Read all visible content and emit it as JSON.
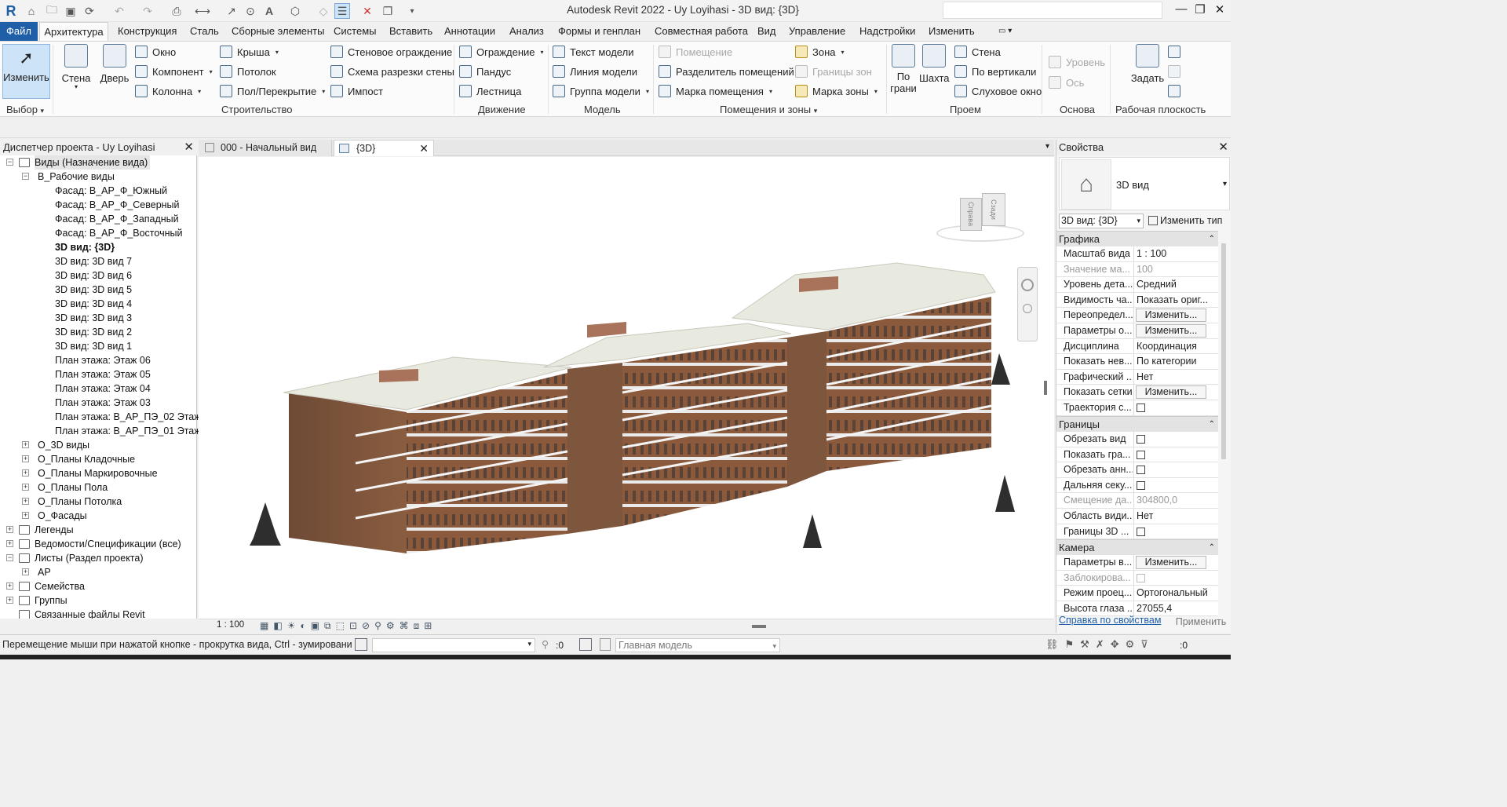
{
  "app": {
    "title": "Autodesk Revit 2022 - Uy Loyihasi - 3D вид: {3D}"
  },
  "colors": {
    "accent": "#1f5fa8",
    "selected": "#cde3f7",
    "facade": "#8b5a3c",
    "roof": "#e8e9df"
  },
  "menu_tabs": [
    "Файл",
    "Архитектура",
    "Конструкция",
    "Сталь",
    "Сборные элементы",
    "Системы",
    "Вставить",
    "Аннотации",
    "Анализ",
    "Формы и генплан",
    "Совместная работа",
    "Вид",
    "Управление",
    "Надстройки",
    "Изменить"
  ],
  "ribbon": {
    "select": {
      "modify": "Изменить",
      "group": "Выбор"
    },
    "build": {
      "wall": "Стена",
      "door": "Дверь",
      "window": "Окно",
      "component": "Компонент",
      "column": "Колонна",
      "roof": "Крыша",
      "ceiling": "Потолок",
      "floor": "Пол/Перекрытие",
      "curtain_system": "Стеновое ограждение",
      "curtain_grid": "Схема разрезки стены",
      "mullion": "Импост",
      "group": "Строительство"
    },
    "circulation": {
      "railing": "Ограждение",
      "ramp": "Пандус",
      "stair": "Лестница",
      "group": "Движение"
    },
    "model": {
      "model_text": "Текст модели",
      "model_line": "Линия  модели",
      "model_group": "Группа модели",
      "group": "Модель"
    },
    "rooms": {
      "room": "Помещение",
      "room_separator": "Разделитель помещений",
      "room_tag": "Марка помещения",
      "area": "Зона",
      "area_boundary": "Границы  зон",
      "area_tag": "Марка  зоны",
      "group": "Помещения и зоны"
    },
    "opening": {
      "by_face": "По\nграни",
      "shaft": "Шахта",
      "wall": "Стена",
      "vertical": "По вертикали",
      "dormer": "Слуховое окно",
      "group": "Проем"
    },
    "datum": {
      "level": "Уровень",
      "grid": "Ось",
      "group": "Основа"
    },
    "workplane": {
      "set": "Задать",
      "group": "Рабочая плоскость"
    }
  },
  "project_browser": {
    "title": "Диспетчер проекта - Uy Loyihasi",
    "items": [
      {
        "label": "Виды (Назначение вида)",
        "level": 0,
        "toggle": "−"
      },
      {
        "label": "В_Рабочие виды",
        "level": 1,
        "toggle": "−"
      },
      {
        "label": "Фасад: В_АР_Ф_Южный",
        "level": 2
      },
      {
        "label": "Фасад: В_АР_Ф_Северный",
        "level": 2
      },
      {
        "label": "Фасад: В_АР_Ф_Западный",
        "level": 2
      },
      {
        "label": "Фасад: В_АР_Ф_Восточный",
        "level": 2
      },
      {
        "label": "3D вид: {3D}",
        "level": 2,
        "bold": true
      },
      {
        "label": "3D вид: 3D вид 7",
        "level": 2
      },
      {
        "label": "3D вид: 3D вид 6",
        "level": 2
      },
      {
        "label": "3D вид: 3D вид 5",
        "level": 2
      },
      {
        "label": "3D вид: 3D вид 4",
        "level": 2
      },
      {
        "label": "3D вид: 3D вид 3",
        "level": 2
      },
      {
        "label": "3D вид: 3D вид 2",
        "level": 2
      },
      {
        "label": "3D вид: 3D вид 1",
        "level": 2
      },
      {
        "label": "План этажа: Этаж 06",
        "level": 2
      },
      {
        "label": "План этажа: Этаж 05",
        "level": 2
      },
      {
        "label": "План этажа: Этаж 04",
        "level": 2
      },
      {
        "label": "План этажа: Этаж 03",
        "level": 2
      },
      {
        "label": "План этажа: В_АР_ПЭ_02 Этаж",
        "level": 2
      },
      {
        "label": "План этажа: В_АР_ПЭ_01 Этаж",
        "level": 2
      },
      {
        "label": "О_3D виды",
        "level": 1,
        "toggle": "+"
      },
      {
        "label": "О_Планы Кладочные",
        "level": 1,
        "toggle": "+"
      },
      {
        "label": "О_Планы Маркировочные",
        "level": 1,
        "toggle": "+"
      },
      {
        "label": "О_Планы Пола",
        "level": 1,
        "toggle": "+"
      },
      {
        "label": "О_Планы Потолка",
        "level": 1,
        "toggle": "+"
      },
      {
        "label": "О_Фасады",
        "level": 1,
        "toggle": "+"
      },
      {
        "label": "Легенды",
        "level": 0,
        "toggle": "+"
      },
      {
        "label": "Ведомости/Спецификации (все)",
        "level": 0,
        "toggle": "+"
      },
      {
        "label": "Листы (Раздел проекта)",
        "level": 0,
        "toggle": "−"
      },
      {
        "label": "АР",
        "level": 1,
        "toggle": "+"
      },
      {
        "label": "Семейства",
        "level": 0,
        "toggle": "+"
      },
      {
        "label": "Группы",
        "level": 0,
        "toggle": "+"
      },
      {
        "label": "Связанные файлы Revit",
        "level": 0
      }
    ]
  },
  "doc_tabs": [
    {
      "label": "000 - Начальный вид",
      "active": false
    },
    {
      "label": "{3D}",
      "active": true
    }
  ],
  "viewcube": {
    "right": "Справа",
    "back": "Сзади"
  },
  "view_scale": "1 : 100",
  "properties": {
    "title": "Свойства",
    "type_name": "3D вид",
    "view_selector": "3D вид: {3D}",
    "edit_type": "Изменить тип",
    "groups": {
      "graphics": "Графика",
      "extents": "Границы",
      "camera": "Камера"
    },
    "rows": [
      {
        "key": "Масштаб вида",
        "value": "1 : 100",
        "kind": "text"
      },
      {
        "key": "Значение ма...",
        "value": "100",
        "kind": "text",
        "disabled": true
      },
      {
        "key": "Уровень дета...",
        "value": "Средний",
        "kind": "text"
      },
      {
        "key": "Видимость ча...",
        "value": "Показать ориг...",
        "kind": "text"
      },
      {
        "key": "Переопредел...",
        "value": "Изменить...",
        "kind": "button"
      },
      {
        "key": "Параметры о...",
        "value": "Изменить...",
        "kind": "button"
      },
      {
        "key": "Дисциплина",
        "value": "Координация",
        "kind": "text"
      },
      {
        "key": "Показать нев...",
        "value": "По категории",
        "kind": "text"
      },
      {
        "key": "Графический ...",
        "value": "Нет",
        "kind": "text"
      },
      {
        "key": "Показать сетки",
        "value": "Изменить...",
        "kind": "button"
      },
      {
        "key": "Траектория с...",
        "value": "",
        "kind": "checkbox"
      },
      {
        "key": "Обрезать вид",
        "value": "",
        "kind": "checkbox"
      },
      {
        "key": "Показать гра...",
        "value": "",
        "kind": "checkbox"
      },
      {
        "key": "Обрезать анн...",
        "value": "",
        "kind": "checkbox"
      },
      {
        "key": "Дальняя секу...",
        "value": "",
        "kind": "checkbox"
      },
      {
        "key": "Смещение да...",
        "value": "304800,0",
        "kind": "text",
        "disabled": true
      },
      {
        "key": "Область види...",
        "value": "Нет",
        "kind": "text"
      },
      {
        "key": "Границы 3D ...",
        "value": "",
        "kind": "checkbox"
      },
      {
        "key": "Параметры в...",
        "value": "Изменить...",
        "kind": "button"
      },
      {
        "key": "Заблокирова...",
        "value": "",
        "kind": "checkbox",
        "disabled": true
      },
      {
        "key": "Режим проец...",
        "value": "Ортогональный",
        "kind": "text"
      },
      {
        "key": "Высота глаза ...",
        "value": "27055,4",
        "kind": "text"
      }
    ],
    "help_link": "Справка по свойствам",
    "apply": "Применить"
  },
  "status": {
    "message": "Перемещение мыши при нажатой кнопке - прокрутка вида, Ctrl - зумирование",
    "workset_count": ":0",
    "model": "Главная модель",
    "filter_count": ":0"
  }
}
